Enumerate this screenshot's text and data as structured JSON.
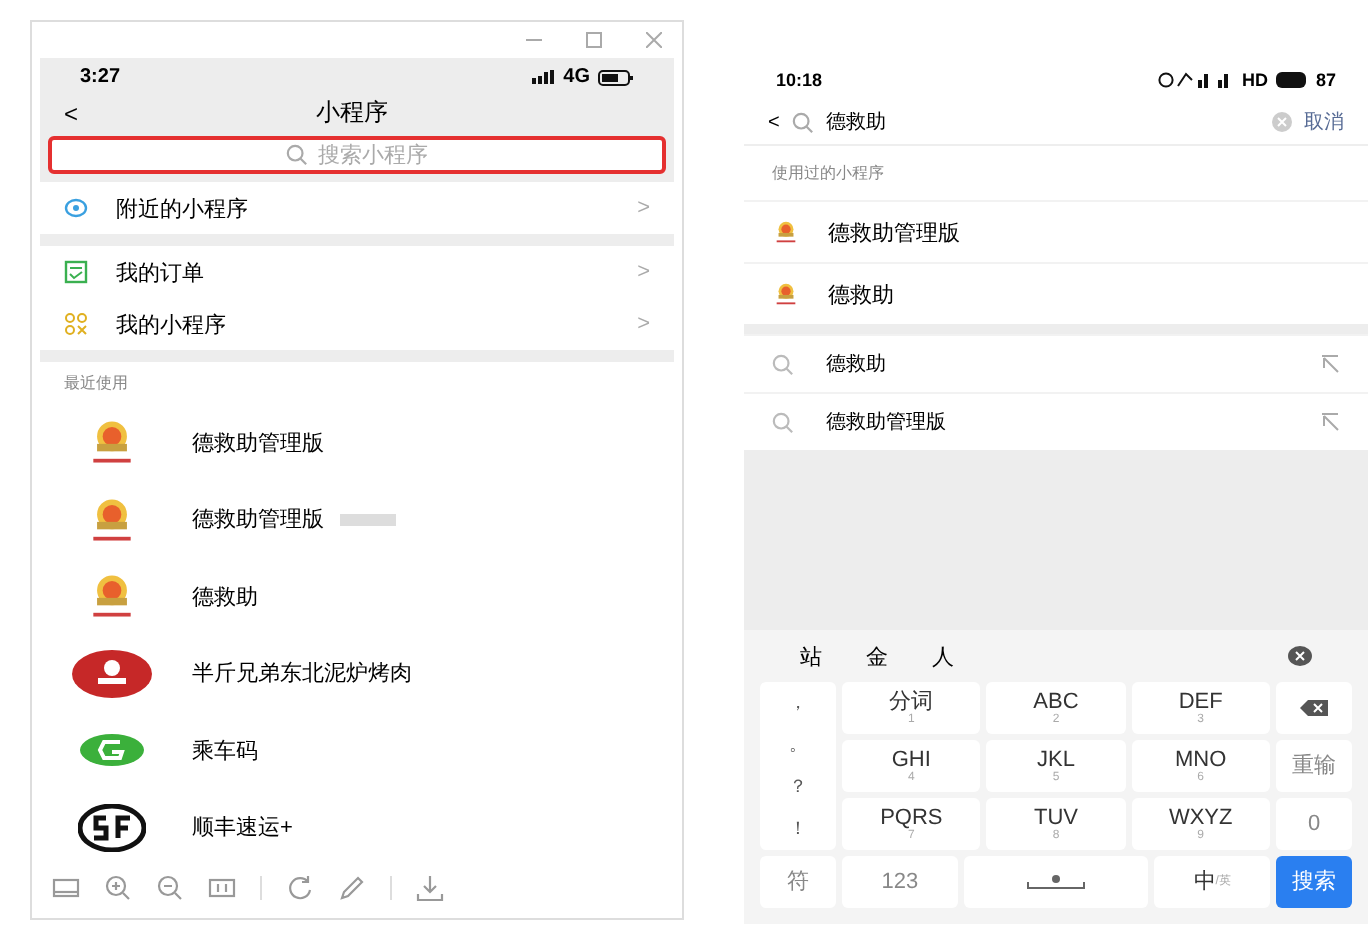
{
  "left_phone": {
    "status_bar": {
      "time": "3:27",
      "network": "4G"
    },
    "nav": {
      "back": "<",
      "title": "小程序"
    },
    "search": {
      "placeholder": "搜索小程序",
      "highlighted": true
    },
    "menu_groups": [
      [
        {
          "kind": "nearby",
          "label": "附近的小程序",
          "chevron": ">"
        }
      ],
      [
        {
          "kind": "orders",
          "label": "我的订单",
          "chevron": ">"
        },
        {
          "kind": "mine",
          "label": "我的小程序",
          "chevron": ">"
        }
      ]
    ],
    "section_label": "最近使用",
    "recent": [
      {
        "kind": "emblem",
        "name": "德救助管理版",
        "trial": false
      },
      {
        "kind": "emblem",
        "name": "德救助管理版",
        "trial": true
      },
      {
        "kind": "emblem",
        "name": "德救助",
        "trial": false
      },
      {
        "kind": "red",
        "name": "半斤兄弟东北泥炉烤肉",
        "trial": false
      },
      {
        "kind": "green",
        "name": "乘车码",
        "trial": false
      },
      {
        "kind": "sf",
        "name": "顺丰速运+",
        "trial": false
      }
    ],
    "toolbar": [
      {
        "kind": "layout"
      },
      {
        "kind": "zoom-in"
      },
      {
        "kind": "zoom-out"
      },
      {
        "kind": "actual-size"
      },
      {
        "kind": "divider"
      },
      {
        "kind": "rotate"
      },
      {
        "kind": "edit"
      },
      {
        "kind": "divider"
      },
      {
        "kind": "download"
      }
    ]
  },
  "right_phone": {
    "status_bar": {
      "time": "10:18",
      "extra": "HD",
      "battery": "87"
    },
    "search": {
      "back": "<",
      "value": "德救助",
      "cancel": "取消"
    },
    "section_label": "使用过的小程序",
    "used": [
      {
        "name": "德救助管理版"
      },
      {
        "name": "德救助"
      }
    ],
    "history": [
      {
        "query": "德救助"
      },
      {
        "query": "德救助管理版"
      }
    ],
    "keyboard": {
      "candidates": [
        "站",
        "金",
        "人"
      ],
      "punctuation": [
        "，",
        "。",
        "？",
        "！"
      ],
      "keys": [
        {
          "label": "分词",
          "digit": "1"
        },
        {
          "label": "ABC",
          "digit": "2"
        },
        {
          "label": "DEF",
          "digit": "3"
        },
        {
          "label": "GHI",
          "digit": "4"
        },
        {
          "label": "JKL",
          "digit": "5"
        },
        {
          "label": "MNO",
          "digit": "6"
        },
        {
          "label": "PQRS",
          "digit": "7"
        },
        {
          "label": "TUV",
          "digit": "8"
        },
        {
          "label": "WXYZ",
          "digit": "9"
        }
      ],
      "reinput": "重输",
      "zero": "0",
      "symbols": "符",
      "numbers": "123",
      "lang_main": "中",
      "lang_alt": "/英",
      "search": "搜索"
    }
  }
}
